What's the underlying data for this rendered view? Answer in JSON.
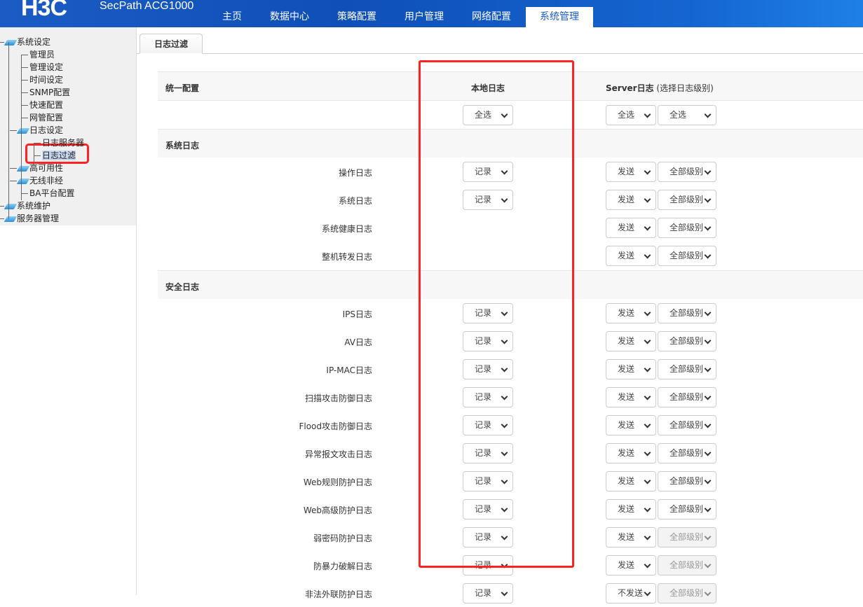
{
  "header": {
    "logo": "H3C",
    "product": "SecPath ACG1000",
    "nav": [
      "主页",
      "数据中心",
      "策略配置",
      "用户管理",
      "网络配置",
      "系统管理"
    ],
    "active": "系统管理"
  },
  "sidebar": {
    "items": [
      {
        "label": "系统设定",
        "level": 0,
        "folder": true
      },
      {
        "label": "管理员",
        "level": 1
      },
      {
        "label": "管理设定",
        "level": 1
      },
      {
        "label": "时间设定",
        "level": 1
      },
      {
        "label": "SNMP配置",
        "level": 1
      },
      {
        "label": "快速配置",
        "level": 1
      },
      {
        "label": "网管配置",
        "level": 1
      },
      {
        "label": "日志设定",
        "level": 1,
        "folder": true
      },
      {
        "label": "日志服务器",
        "level": 2
      },
      {
        "label": "日志过滤",
        "level": 2,
        "selected": true
      },
      {
        "label": "高可用性",
        "level": 1,
        "folder": true
      },
      {
        "label": "无线非经",
        "level": 1,
        "folder": true
      },
      {
        "label": "BA平台配置",
        "level": 1
      },
      {
        "label": "系统维护",
        "level": 0,
        "folder": true
      },
      {
        "label": "服务器管理",
        "level": 0,
        "folder": true
      }
    ]
  },
  "tab": "日志过滤",
  "table": {
    "header": {
      "col1": "统一配置",
      "col2": "本地日志",
      "col3": "Server日志",
      "col3_note": "(选择日志级别)"
    },
    "unified": {
      "local": "全选",
      "server": "全选",
      "level": "全选"
    },
    "sections": [
      {
        "title": "系统日志",
        "rows": [
          {
            "name": "操作日志",
            "local": "记录",
            "server": "发送",
            "level": "全部级别"
          },
          {
            "name": "系统日志",
            "local": "记录",
            "server": "发送",
            "level": "全部级别"
          },
          {
            "name": "系统健康日志",
            "local": null,
            "server": "发送",
            "level": "全部级别"
          },
          {
            "name": "整机转发日志",
            "local": null,
            "server": "发送",
            "level": "全部级别"
          }
        ]
      },
      {
        "title": "安全日志",
        "rows": [
          {
            "name": "IPS日志",
            "local": "记录",
            "server": "发送",
            "level": "全部级别"
          },
          {
            "name": "AV日志",
            "local": "记录",
            "server": "发送",
            "level": "全部级别"
          },
          {
            "name": "IP-MAC日志",
            "local": "记录",
            "server": "发送",
            "level": "全部级别"
          },
          {
            "name": "扫描攻击防御日志",
            "local": "记录",
            "server": "发送",
            "level": "全部级别"
          },
          {
            "name": "Flood攻击防御日志",
            "local": "记录",
            "server": "发送",
            "level": "全部级别"
          },
          {
            "name": "异常报文攻击日志",
            "local": "记录",
            "server": "发送",
            "level": "全部级别"
          },
          {
            "name": "Web规则防护日志",
            "local": "记录",
            "server": "发送",
            "level": "全部级别"
          },
          {
            "name": "Web高级防护日志",
            "local": "记录",
            "server": "发送",
            "level": "全部级别"
          },
          {
            "name": "弱密码防护日志",
            "local": "记录",
            "server": "发送",
            "level": "全部级别",
            "level_disabled": true
          },
          {
            "name": "防暴力破解日志",
            "local": "记录",
            "server": "发送",
            "level": "全部级别",
            "level_disabled": true
          },
          {
            "name": "非法外联防护日志",
            "local": "记录",
            "server": "不发送",
            "level": "全部级别",
            "level_disabled": true
          }
        ]
      }
    ]
  }
}
